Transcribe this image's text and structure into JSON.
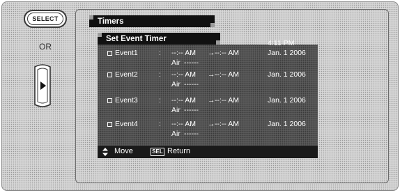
{
  "remote": {
    "select_label": "SELECT",
    "or_label": "OR"
  },
  "menu": {
    "title": "Timers",
    "subtitle": "Set Event Timer",
    "clock": "4:11 PM"
  },
  "events": [
    {
      "name": "Event1",
      "colon": ":",
      "start": "--:-- AM",
      "arrow": "→",
      "end": "--:-- AM",
      "date": "Jan. 1 2006",
      "source": "Air",
      "channel": "------"
    },
    {
      "name": "Event2",
      "colon": ":",
      "start": "--:-- AM",
      "arrow": "→",
      "end": "--:-- AM",
      "date": "Jan. 1 2006",
      "source": "Air",
      "channel": "------"
    },
    {
      "name": "Event3",
      "colon": ":",
      "start": "--:-- AM",
      "arrow": "→",
      "end": "--:-- AM",
      "date": "Jan. 1 2006",
      "source": "Air",
      "channel": "------"
    },
    {
      "name": "Event4",
      "colon": ":",
      "start": "--:-- AM",
      "arrow": "→",
      "end": "--:-- AM",
      "date": "Jan. 1 2006",
      "source": "Air",
      "channel": "------"
    }
  ],
  "footer": {
    "move_icon": "up-down-arrows-icon",
    "move_label": "Move",
    "sel_icon_text": "SEL",
    "return_label": "Return"
  },
  "colors": {
    "panel_bg": "#5a5a5a",
    "tab_bg": "#111111",
    "text": "#ffffff"
  }
}
